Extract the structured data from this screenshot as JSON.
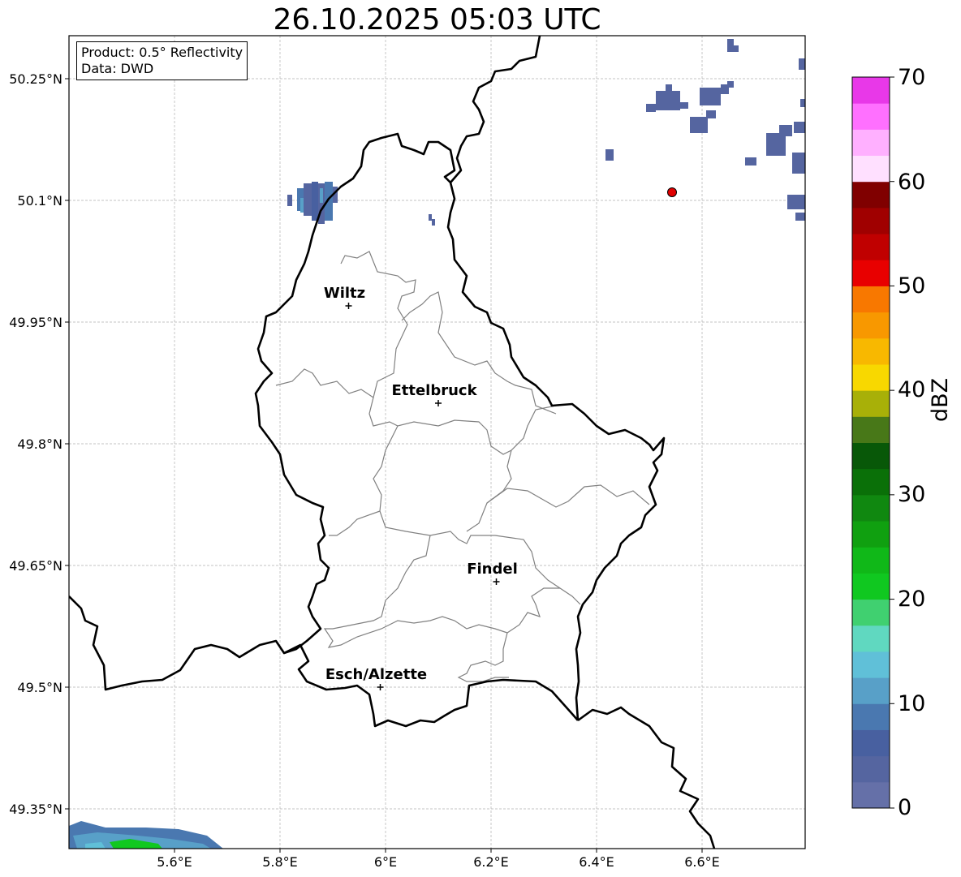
{
  "title": "26.10.2025 05:03 UTC",
  "info": {
    "product": "Product: 0.5° Reflectivity",
    "data": "Data: DWD"
  },
  "axes": {
    "x_ticks": [
      "5.6°E",
      "5.8°E",
      "6°E",
      "6.2°E",
      "6.4°E",
      "6.6°E"
    ],
    "y_ticks": [
      "50.25°N",
      "50.1°N",
      "49.95°N",
      "49.8°N",
      "49.65°N",
      "49.5°N",
      "49.35°N"
    ]
  },
  "cities": [
    {
      "name": "Wiltz",
      "lon": 5.93,
      "lat": 49.97
    },
    {
      "name": "Ettelbruck",
      "lon": 6.1,
      "lat": 49.85
    },
    {
      "name": "Findel",
      "lon": 6.21,
      "lat": 49.63
    },
    {
      "name": "Esch/Alzette",
      "lon": 5.99,
      "lat": 49.5
    }
  ],
  "marker": {
    "lon": 6.55,
    "lat": 50.11,
    "color": "#e00000"
  },
  "colorbar": {
    "title": "dBZ",
    "tick_labels": [
      "70",
      "60",
      "50",
      "40",
      "30",
      "20",
      "10",
      "0"
    ],
    "colors": [
      "#6570a8",
      "#5565a0",
      "#4860a0",
      "#4a78b0",
      "#58a0c8",
      "#60c0d8",
      "#60d8c0",
      "#40d070",
      "#10c820",
      "#10b818",
      "#10a010",
      "#108810",
      "#0a7008",
      "#085808",
      "#487818",
      "#a8b008",
      "#f8d800",
      "#f8b800",
      "#f89800",
      "#f87800",
      "#e80000",
      "#c00000",
      "#a00000",
      "#800000",
      "#ffe0ff",
      "#ffb0ff",
      "#ff70ff",
      "#e838e8"
    ]
  }
}
